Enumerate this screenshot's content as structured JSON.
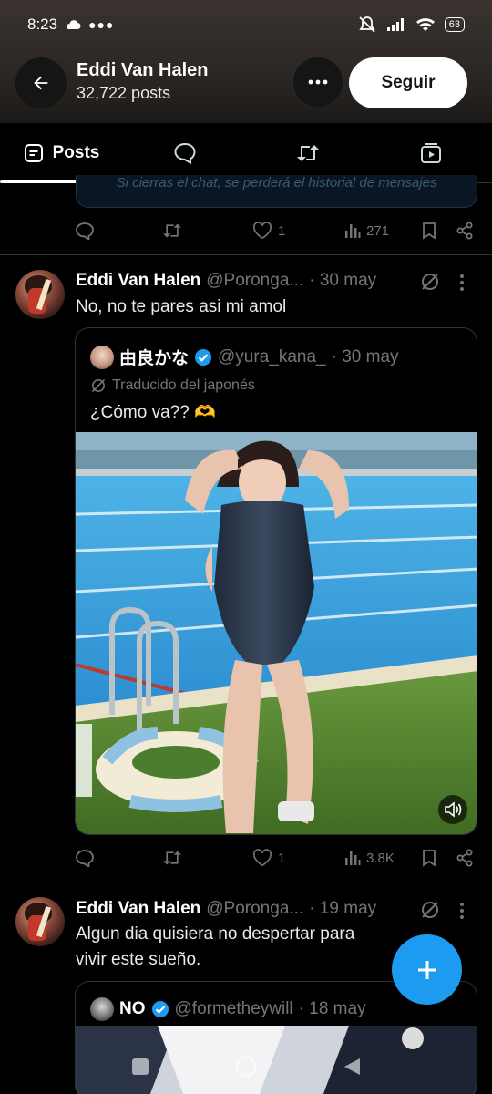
{
  "status_bar": {
    "time": "8:23",
    "battery": "63"
  },
  "header": {
    "profile_name": "Eddi Van Halen",
    "post_count": "32,722 posts",
    "follow_label": "Seguir"
  },
  "tabs": [
    {
      "label": "Posts",
      "icon": "posts-icon",
      "active": true
    },
    {
      "label": "",
      "icon": "replies-icon"
    },
    {
      "label": "",
      "icon": "reposts-icon"
    },
    {
      "label": "",
      "icon": "media-icon"
    }
  ],
  "previous_post": {
    "stub_text": "Si cierras el chat, se perderá el historial de mensajes",
    "actions": {
      "likes": "1",
      "views": "271"
    }
  },
  "posts": [
    {
      "author": "Eddi Van Halen",
      "handle": "@Poronga...",
      "date": "· 30 may",
      "text": "No, no te pares asi mi amol",
      "quote": {
        "name": "由良かな",
        "handle": "@yura_kana_",
        "date": "· 30 may",
        "translated_label": "Traducido del japonés",
        "text": "¿Cómo va?? 🫶"
      },
      "actions": {
        "likes": "1",
        "views": "3.8K"
      }
    },
    {
      "author": "Eddi Van Halen",
      "handle": "@Poronga...",
      "date": "· 19 may",
      "text": "Algun dia quisiera no despertar para vivir este sueño.",
      "quote": {
        "name": "NO",
        "handle": "@formetheywill",
        "date": "· 18 may"
      }
    }
  ],
  "colors": {
    "accent": "#1d9bf0",
    "verified": "#1d9bf0",
    "muted": "#71767b"
  }
}
